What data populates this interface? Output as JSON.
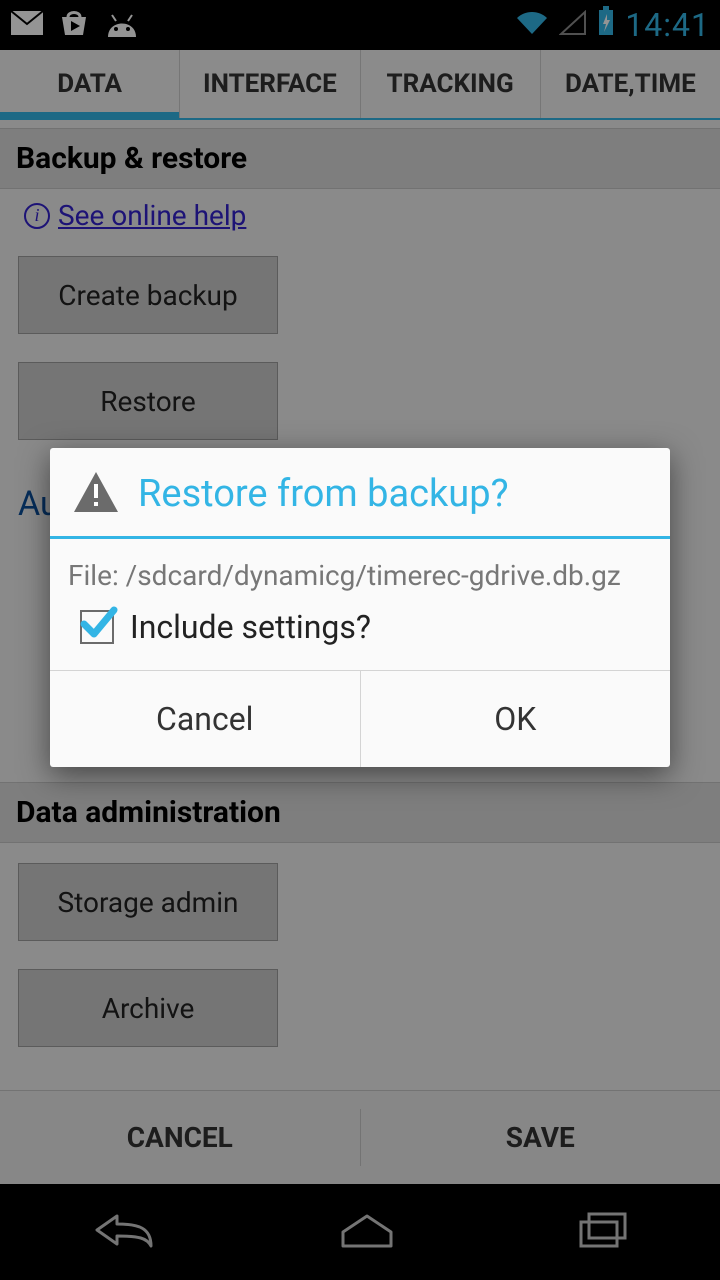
{
  "status": {
    "time": "14:41"
  },
  "tabs": [
    "DATA",
    "INTERFACE",
    "TRACKING",
    "DATE,TIME"
  ],
  "sections": {
    "backup_restore": {
      "title": "Backup & restore",
      "help": "See online help",
      "buttons": {
        "create": "Create backup",
        "restore": "Restore"
      }
    },
    "auto_prefix": "Au",
    "data_admin": {
      "title": "Data administration",
      "buttons": {
        "storage": "Storage admin",
        "archive": "Archive"
      }
    }
  },
  "bottom": {
    "cancel": "CANCEL",
    "save": "SAVE"
  },
  "dialog": {
    "title": "Restore from backup?",
    "file_label": "File: /sdcard/dynamicg/timerec-gdrive.db.gz",
    "checkbox_label": "Include settings?",
    "checkbox_checked": true,
    "cancel": "Cancel",
    "ok": "OK"
  }
}
